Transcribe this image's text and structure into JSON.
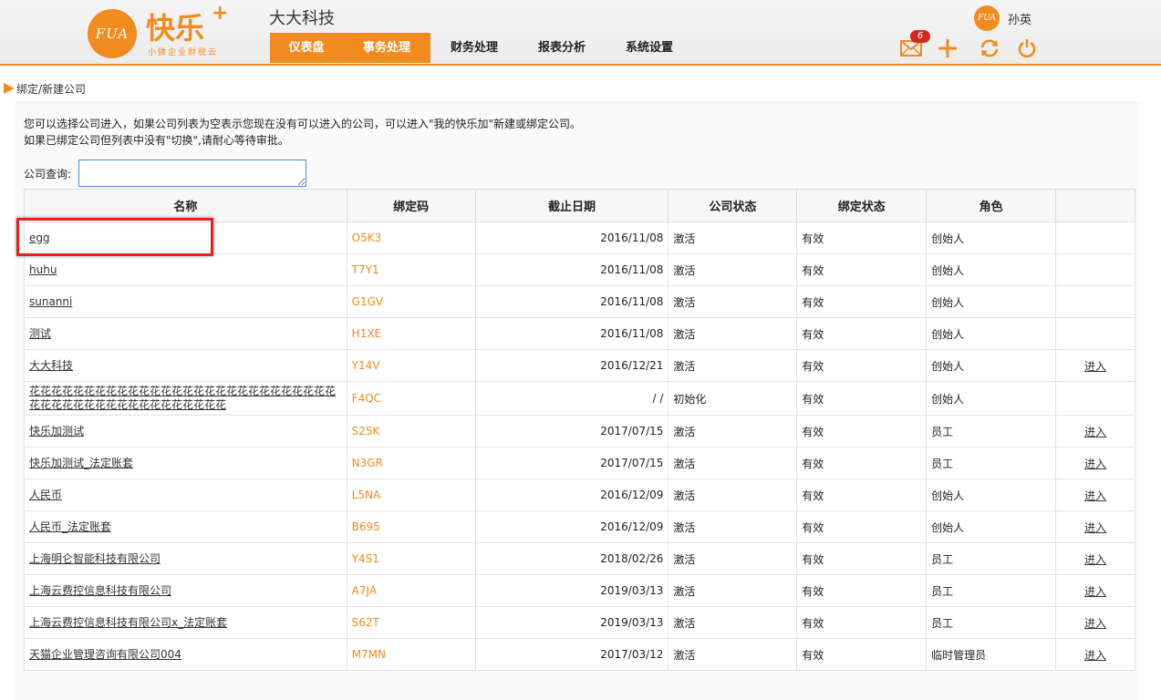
{
  "brand": {
    "logo_text": "FUA",
    "name": "快乐",
    "plus": "+",
    "slogan": "小微企业财税云"
  },
  "header": {
    "company": "大大科技",
    "user_name": "孙英",
    "mail_count": "6",
    "nav": [
      "仪表盘",
      "事务处理",
      "财务处理",
      "报表分析",
      "系统设置"
    ],
    "accent_color": "#ef8b1f"
  },
  "breadcrumb": "绑定/新建公司",
  "notice": {
    "line1": "您可以选择公司进入，如果公司列表为空表示您现在没有可以进入的公司，可以进入\"我的快乐加\"新建或绑定公司。",
    "line2": "如果已绑定公司但列表中没有\"切换\",请耐心等待审批。"
  },
  "search": {
    "label": "公司查询:",
    "value": ""
  },
  "table": {
    "headers": [
      "名称",
      "绑定码",
      "截止日期",
      "公司状态",
      "绑定状态",
      "角色",
      ""
    ],
    "rows": [
      {
        "name": "egg",
        "code": "O5K3",
        "date": "2016/11/08",
        "status": "激活",
        "bind": "有效",
        "role": "创始人",
        "action": ""
      },
      {
        "name": "huhu",
        "code": "T7Y1",
        "date": "2016/11/08",
        "status": "激活",
        "bind": "有效",
        "role": "创始人",
        "action": ""
      },
      {
        "name": "sunanni",
        "code": "G1GV",
        "date": "2016/11/08",
        "status": "激活",
        "bind": "有效",
        "role": "创始人",
        "action": ""
      },
      {
        "name": "测试",
        "code": "H1XE",
        "date": "2016/11/08",
        "status": "激活",
        "bind": "有效",
        "role": "创始人",
        "action": ""
      },
      {
        "name": "大大科技",
        "code": "Y14V",
        "date": "2016/12/21",
        "status": "激活",
        "bind": "有效",
        "role": "创始人",
        "action": "进入"
      },
      {
        "name": "花花花花花花花花花花花花花花花花花花花花花花花花花花花花花花花花花花花花花花花花花花花花花花",
        "code": "F4QC",
        "date": "/ /",
        "status": "初始化",
        "bind": "有效",
        "role": "创始人",
        "action": ""
      },
      {
        "name": "快乐加测试",
        "code": "S25K",
        "date": "2017/07/15",
        "status": "激活",
        "bind": "有效",
        "role": "员工",
        "action": "进入"
      },
      {
        "name": "快乐加测试_法定账套",
        "code": "N3GR",
        "date": "2017/07/15",
        "status": "激活",
        "bind": "有效",
        "role": "员工",
        "action": "进入"
      },
      {
        "name": "人民币",
        "code": "L5NA",
        "date": "2016/12/09",
        "status": "激活",
        "bind": "有效",
        "role": "创始人",
        "action": "进入"
      },
      {
        "name": "人民币_法定账套",
        "code": "B695",
        "date": "2016/12/09",
        "status": "激活",
        "bind": "有效",
        "role": "创始人",
        "action": "进入"
      },
      {
        "name": "上海明仑智能科技有限公司",
        "code": "Y4S1",
        "date": "2018/02/26",
        "status": "激活",
        "bind": "有效",
        "role": "员工",
        "action": "进入"
      },
      {
        "name": "上海云费控信息科技有限公司",
        "code": "A7JA",
        "date": "2019/03/13",
        "status": "激活",
        "bind": "有效",
        "role": "员工",
        "action": "进入"
      },
      {
        "name": "上海云费控信息科技有限公司x_法定账套",
        "code": "S62T",
        "date": "2019/03/13",
        "status": "激活",
        "bind": "有效",
        "role": "员工",
        "action": "进入"
      },
      {
        "name": "天猫企业管理咨询有限公司004",
        "code": "M7MN",
        "date": "2017/03/12",
        "status": "激活",
        "bind": "有效",
        "role": "临时管理员",
        "action": "进入"
      }
    ]
  }
}
